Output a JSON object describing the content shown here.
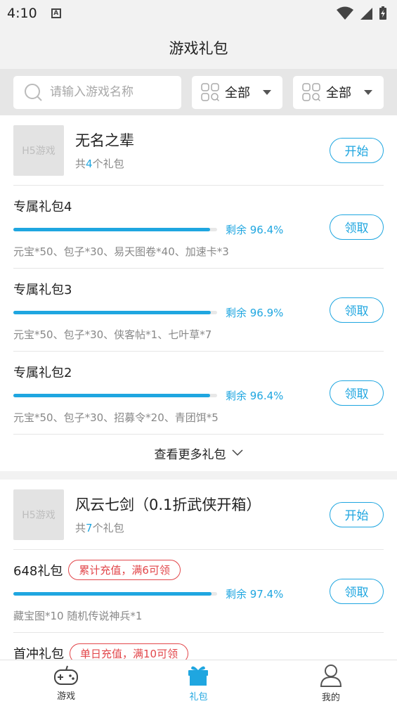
{
  "status_bar": {
    "time": "4:10"
  },
  "header": {
    "title": "游戏礼包"
  },
  "filters": {
    "search_placeholder": "请输入游戏名称",
    "dropdown1": "全部",
    "dropdown2": "全部"
  },
  "games": [
    {
      "thumb": "H5游戏",
      "name": "无名之辈",
      "count_prefix": "共",
      "count": "4",
      "count_suffix": "个礼包",
      "action": "开始",
      "gifts": [
        {
          "title": "专属礼包4",
          "remain_label": "剩余 96.4%",
          "remain_pct": 96.4,
          "desc": "元宝*50、包子*30、易天图卷*40、加速卡*3",
          "action": "领取"
        },
        {
          "title": "专属礼包3",
          "remain_label": "剩余 96.9%",
          "remain_pct": 96.9,
          "desc": "元宝*50、包子*30、侠客帖*1、七叶草*7",
          "action": "领取"
        },
        {
          "title": "专属礼包2",
          "remain_label": "剩余 96.4%",
          "remain_pct": 96.4,
          "desc": "元宝*50、包子*30、招募令*20、青团饵*5",
          "action": "领取"
        }
      ],
      "more": "查看更多礼包"
    },
    {
      "thumb": "H5游戏",
      "name": "风云七剑（0.1折武侠开箱）",
      "count_prefix": "共",
      "count": "7",
      "count_suffix": "个礼包",
      "action": "开始",
      "gifts": [
        {
          "title": "648礼包",
          "tag": "累计充值，满6可领",
          "remain_label": "剩余 97.4%",
          "remain_pct": 97.4,
          "desc": "藏宝图*10 随机传说神兵*1",
          "action": "领取"
        },
        {
          "title": "首冲礼包",
          "tag": "单日充值，满10可领"
        }
      ]
    }
  ],
  "bottom_nav": [
    {
      "label": "游戏",
      "icon": "gamepad-icon"
    },
    {
      "label": "礼包",
      "icon": "gift-icon",
      "active": true
    },
    {
      "label": "我的",
      "icon": "user-icon"
    }
  ],
  "colors": {
    "accent": "#1fa6e0",
    "tag_red": "#e2474b"
  }
}
